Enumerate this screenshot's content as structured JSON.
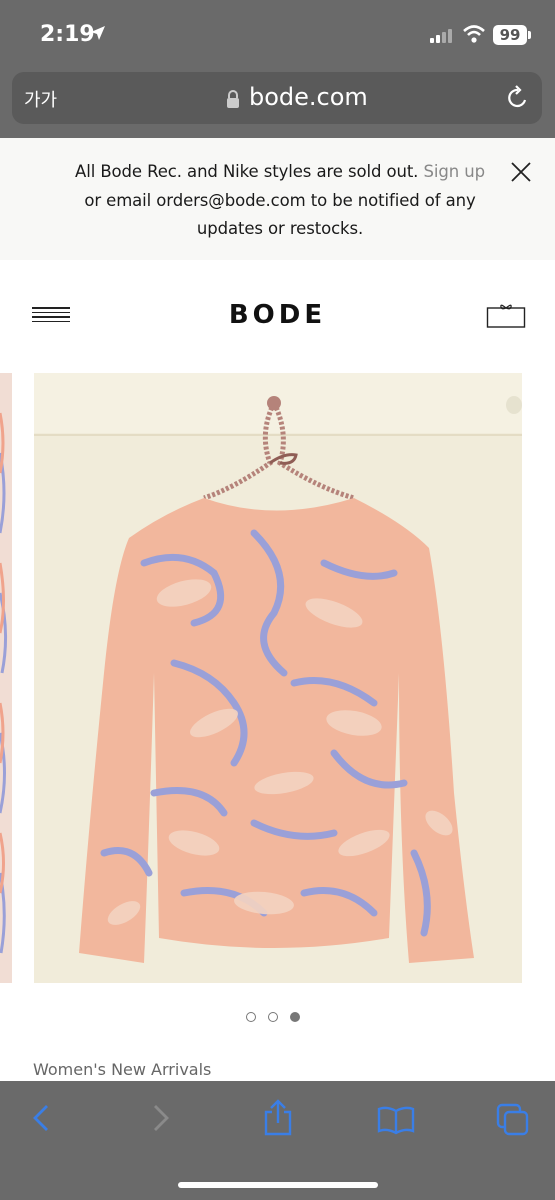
{
  "status_bar": {
    "time": "2:19",
    "battery": "99"
  },
  "browser": {
    "text_size": "가가",
    "url": "bode.com"
  },
  "banner": {
    "message_part1": "All Bode Rec. and Nike styles are sold out.",
    "link": "Sign up",
    "message_part2": "or email orders@bode.com to be notified of any updates or restocks."
  },
  "header": {
    "logo": "BODE"
  },
  "carousel": {
    "slide_count": 3,
    "active_slide": 3
  },
  "section": {
    "label": "Women's New Arrivals"
  },
  "colors": {
    "chrome": "#6a6a6a",
    "link_blue": "#3a7ee6",
    "garment": "#f2b79d"
  }
}
